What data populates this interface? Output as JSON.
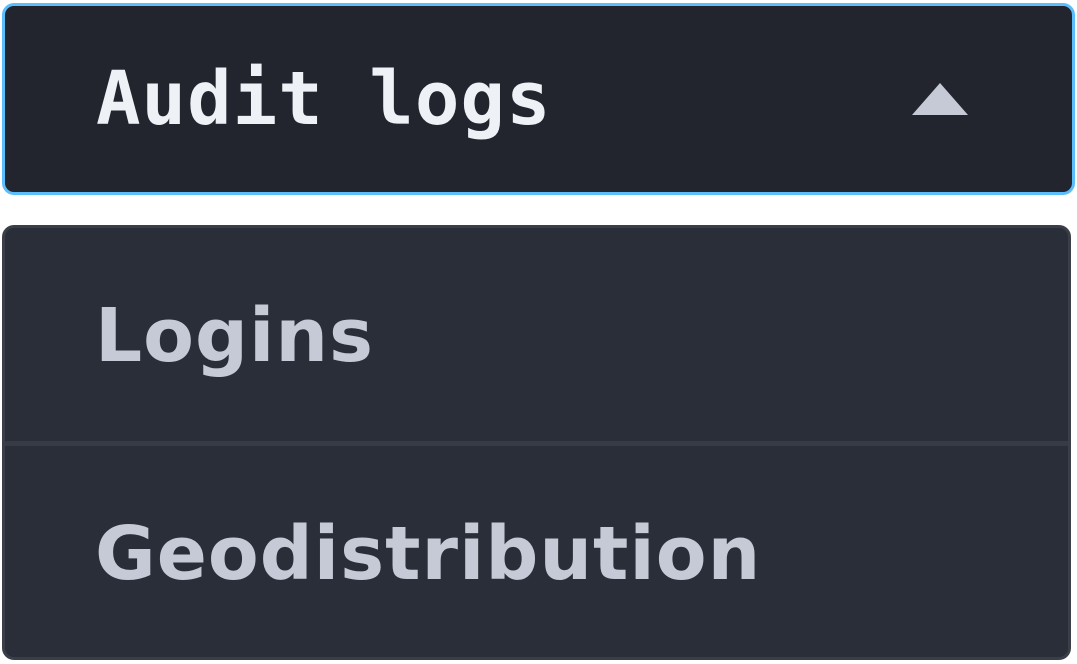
{
  "dropdown": {
    "selected_label": "Audit logs",
    "expanded": true,
    "caret_icon": "caret-up-icon",
    "options": [
      {
        "label": "Logins"
      },
      {
        "label": "Geodistribution"
      }
    ]
  },
  "colors": {
    "focus_border": "#5cbdfb",
    "select_background": "#22252e",
    "menu_background": "#2a2e38",
    "selected_text": "#eef1f6",
    "option_text": "#c6cad6"
  }
}
